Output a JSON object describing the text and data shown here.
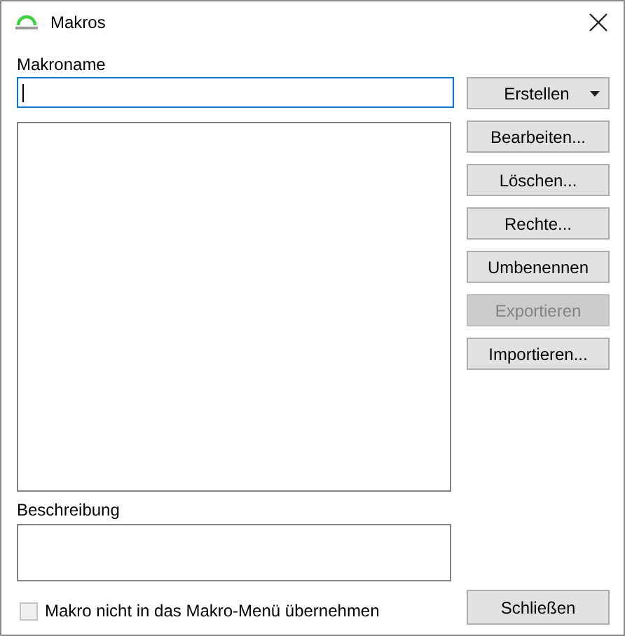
{
  "window": {
    "title": "Makros"
  },
  "name_field": {
    "label": "Makroname"
  },
  "description": {
    "label": "Beschreibung"
  },
  "buttons": [
    {
      "label": "Erstellen",
      "kind": "dropdown",
      "disabled": false
    },
    {
      "label": "Bearbeiten...",
      "kind": "plain",
      "disabled": false
    },
    {
      "label": "Löschen...",
      "kind": "plain",
      "disabled": false
    },
    {
      "label": "Rechte...",
      "kind": "plain",
      "disabled": false
    },
    {
      "label": "Umbenennen",
      "kind": "plain",
      "disabled": false
    },
    {
      "label": "Exportieren",
      "kind": "plain",
      "disabled": true
    },
    {
      "label": "Importieren...",
      "kind": "plain",
      "disabled": false
    }
  ],
  "option": {
    "label": "Makro nicht in das Makro-Menü übernehmen",
    "checked": false
  },
  "close_button": {
    "label": "Schließen"
  }
}
